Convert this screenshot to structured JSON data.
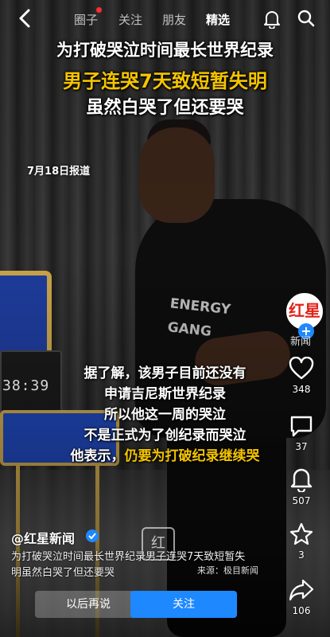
{
  "nav": {
    "tabs": [
      "圈子",
      "关注",
      "朋友",
      "精选"
    ],
    "active_tab": "精选"
  },
  "video": {
    "headline_1": "为打破哭泣时间最长世界纪录",
    "headline_2": "男子连哭7天致短暂失明",
    "headline_3": "虽然白哭了但还要哭",
    "date": "7月18日报道",
    "clock_display": "38:39",
    "shirt_print": "ENERGY GANG",
    "subtitle_lines": [
      "据了解，该男子目前还没有",
      "申请吉尼斯世界纪录",
      "所以他这一周的哭泣",
      "不是正式为了创纪录而哭泣"
    ],
    "subtitle_last_prefix": "他表示，",
    "subtitle_last_highlight": "仍要为打破纪录继续哭"
  },
  "side": {
    "avatar_logo": "红星",
    "avatar_tag": "新闻",
    "like_count": "348",
    "comment_count": "37",
    "share_count": "507",
    "favorite_count": "3",
    "forward_count": "106"
  },
  "post": {
    "author": "@红星新闻",
    "description": "为打破哭泣时间最长世界纪录男子连哭7天致短暂失明虽然白哭了但还要哭",
    "source": "来源：极目新闻",
    "watermark": "红"
  },
  "buttons": {
    "later": "以后再说",
    "follow": "关注"
  },
  "colors": {
    "accent_yellow": "#f4c400",
    "follow_blue": "#1e88ff",
    "notify_red": "#ff2d2d"
  }
}
